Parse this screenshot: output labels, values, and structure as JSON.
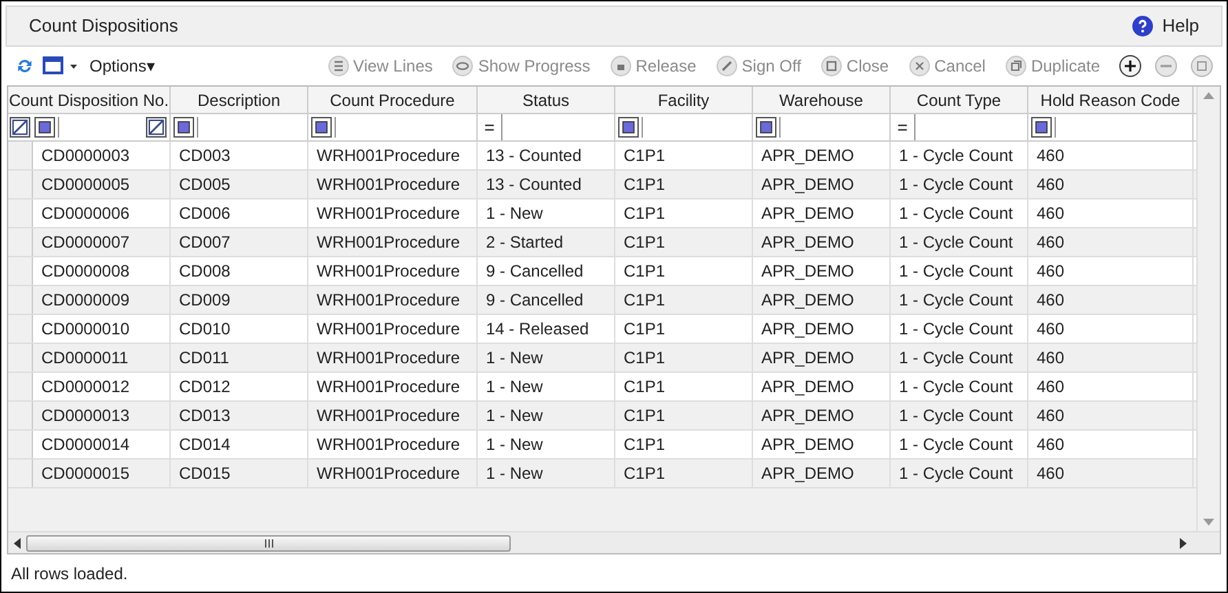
{
  "window": {
    "title": "Count Dispositions",
    "help": "Help"
  },
  "toolbar": {
    "options": "Options▾",
    "actions": [
      {
        "label": "View Lines",
        "disabled": true
      },
      {
        "label": "Show Progress",
        "disabled": true
      },
      {
        "label": "Release",
        "disabled": true
      },
      {
        "label": "Sign Off",
        "disabled": true
      },
      {
        "label": "Close",
        "disabled": true
      },
      {
        "label": "Cancel",
        "disabled": true
      },
      {
        "label": "Duplicate",
        "disabled": true
      }
    ],
    "row_buttons": [
      {
        "kind": "add",
        "disabled": false
      },
      {
        "kind": "remove",
        "disabled": true
      },
      {
        "kind": "more",
        "disabled": true
      }
    ]
  },
  "table": {
    "columns": [
      {
        "label": "Count Disposition No.",
        "kind": "box"
      },
      {
        "label": "Description",
        "kind": "box"
      },
      {
        "label": "Count Procedure",
        "kind": "box"
      },
      {
        "label": "Status",
        "kind": "equals",
        "operator": "="
      },
      {
        "label": "Facility",
        "kind": "box"
      },
      {
        "label": "Warehouse",
        "kind": "box"
      },
      {
        "label": "Count Type",
        "kind": "equals",
        "operator": "="
      },
      {
        "label": "Hold Reason Code",
        "kind": "box"
      }
    ],
    "rows": [
      [
        "CD0000003",
        "CD003",
        "WRH001Procedure",
        "13 - Counted",
        "C1P1",
        "APR_DEMO",
        "1 - Cycle Count",
        "460"
      ],
      [
        "CD0000005",
        "CD005",
        "WRH001Procedure",
        "13 - Counted",
        "C1P1",
        "APR_DEMO",
        "1 - Cycle Count",
        "460"
      ],
      [
        "CD0000006",
        "CD006",
        "WRH001Procedure",
        "1 - New",
        "C1P1",
        "APR_DEMO",
        "1 - Cycle Count",
        "460"
      ],
      [
        "CD0000007",
        "CD007",
        "WRH001Procedure",
        "2 - Started",
        "C1P1",
        "APR_DEMO",
        "1 - Cycle Count",
        "460"
      ],
      [
        "CD0000008",
        "CD008",
        "WRH001Procedure",
        "9 - Cancelled",
        "C1P1",
        "APR_DEMO",
        "1 - Cycle Count",
        "460"
      ],
      [
        "CD0000009",
        "CD009",
        "WRH001Procedure",
        "9 - Cancelled",
        "C1P1",
        "APR_DEMO",
        "1 - Cycle Count",
        "460"
      ],
      [
        "CD0000010",
        "CD010",
        "WRH001Procedure",
        "14 - Released",
        "C1P1",
        "APR_DEMO",
        "1 - Cycle Count",
        "460"
      ],
      [
        "CD0000011",
        "CD011",
        "WRH001Procedure",
        "1 - New",
        "C1P1",
        "APR_DEMO",
        "1 - Cycle Count",
        "460"
      ],
      [
        "CD0000012",
        "CD012",
        "WRH001Procedure",
        "1 - New",
        "C1P1",
        "APR_DEMO",
        "1 - Cycle Count",
        "460"
      ],
      [
        "CD0000013",
        "CD013",
        "WRH001Procedure",
        "1 - New",
        "C1P1",
        "APR_DEMO",
        "1 - Cycle Count",
        "460"
      ],
      [
        "CD0000014",
        "CD014",
        "WRH001Procedure",
        "1 - New",
        "C1P1",
        "APR_DEMO",
        "1 - Cycle Count",
        "460"
      ],
      [
        "CD0000015",
        "CD015",
        "WRH001Procedure",
        "1 - New",
        "C1P1",
        "APR_DEMO",
        "1 - Cycle Count",
        "460"
      ]
    ]
  },
  "status_bar": "All rows loaded."
}
